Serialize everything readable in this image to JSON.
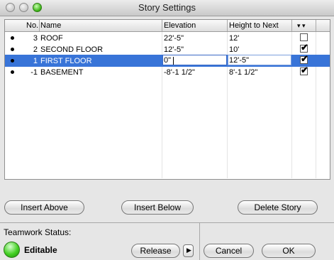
{
  "window": {
    "title": "Story Settings"
  },
  "table": {
    "headers": {
      "no": "No.",
      "name": "Name",
      "elevation": "Elevation",
      "height": "Height to Next",
      "sort_icon": "▾ ▾"
    },
    "rows": [
      {
        "no": "3",
        "name": "ROOF",
        "elevation": "22'-5\"",
        "height": "12'",
        "checked": false,
        "selected": false
      },
      {
        "no": "2",
        "name": "SECOND FLOOR",
        "elevation": "12'-5\"",
        "height": "10'",
        "checked": true,
        "selected": false
      },
      {
        "no": "1",
        "name": "FIRST FLOOR",
        "elevation": "0\"",
        "height": "12'-5\"",
        "checked": true,
        "selected": true
      },
      {
        "no": "-1",
        "name": "BASEMENT",
        "elevation": "-8'-1 1/2\"",
        "height": "8'-1 1/2\"",
        "checked": true,
        "selected": false
      }
    ]
  },
  "buttons": {
    "insert_above": "Insert Above",
    "insert_below": "Insert Below",
    "delete_story": "Delete Story",
    "release": "Release",
    "cancel": "Cancel",
    "ok": "OK"
  },
  "teamwork": {
    "label": "Teamwork Status:",
    "status": "Editable",
    "status_color": "#44d024"
  },
  "icons": {
    "check": "✔",
    "arrow": "▶"
  },
  "colors": {
    "selection": "#3874d8"
  }
}
